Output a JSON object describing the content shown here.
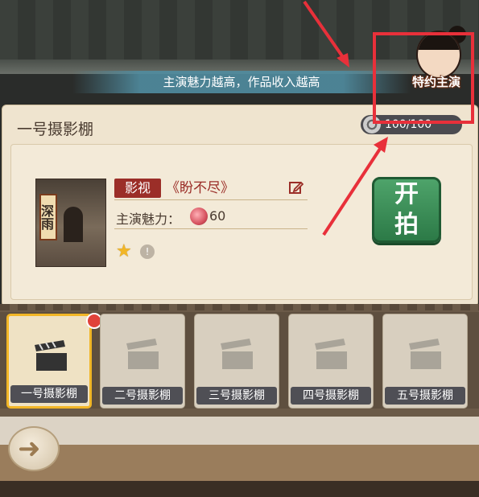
{
  "banner": {
    "text": "主演魅力越高，作品收入越高"
  },
  "special_actor": {
    "label": "特约主演"
  },
  "studio_panel": {
    "title": "一号摄影棚",
    "counter": "100/100",
    "poster_text": "深雨",
    "genre": "影视",
    "work_title": "《盼不尽》",
    "charm_label": "主演魅力：",
    "charm_value": "60",
    "start_button": {
      "line1": "开",
      "line2": "拍"
    }
  },
  "studios": [
    {
      "label": "一号摄影棚",
      "active": true,
      "has_notification": true
    },
    {
      "label": "二号摄影棚",
      "active": false
    },
    {
      "label": "三号摄影棚",
      "active": false
    },
    {
      "label": "四号摄影棚",
      "active": false
    },
    {
      "label": "五号摄影棚",
      "active": false
    }
  ],
  "colors": {
    "annotation": "#e8303a",
    "start_button": "#2c7a47",
    "genre_tag": "#9b2e28",
    "star": "#f2b626"
  }
}
